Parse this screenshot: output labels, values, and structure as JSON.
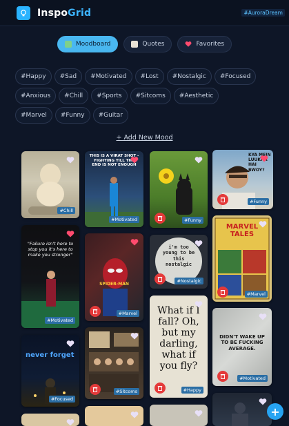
{
  "app": {
    "brand_main": "Inspo",
    "brand_accent": "Grid",
    "user_tag": "#AuroraDream"
  },
  "tabs": [
    {
      "label": "Moodboard",
      "active": true
    },
    {
      "label": "Quotes",
      "active": false
    },
    {
      "label": "Favorites",
      "active": false
    }
  ],
  "moods": [
    "#Happy",
    "#Sad",
    "#Motivated",
    "#Lost",
    "#Nostalgic",
    "#Focused",
    "#Anxious",
    "#Chill",
    "#Sports",
    "#Sitcoms",
    "#Aesthetic",
    "#Marvel",
    "#Funny",
    "#Guitar"
  ],
  "add_mood_label": "+ Add New Mood",
  "cards": [
    {
      "tag": "#Chill",
      "favorited": false,
      "caption": ""
    },
    {
      "tag": "#Motivated",
      "favorited": true,
      "caption": "THIS IS A VIRAT SHOT - FIGHTING TILL THE END IS NOT ENOUGH"
    },
    {
      "tag": "#Funny",
      "favorited": false,
      "caption": ""
    },
    {
      "tag": "#Funny",
      "favorited": true,
      "caption": "KYA MEIN LUUKHA HAI BWOY?"
    },
    {
      "tag": "#Motivated",
      "favorited": true,
      "caption": "\"Failure isn't here to stop you it's here to make you stronger\""
    },
    {
      "tag": "#Marvel",
      "favorited": true,
      "caption": "SPIDER-MAN"
    },
    {
      "tag": "#Nostalgic",
      "favorited": false,
      "caption": "i'm too young to be this nostalgic"
    },
    {
      "tag": "#Marvel",
      "favorited": false,
      "caption": "MARVEL TALES"
    },
    {
      "tag": "#Focused",
      "favorited": false,
      "caption": "never forget"
    },
    {
      "tag": "#Sitcoms",
      "favorited": false,
      "caption": ""
    },
    {
      "tag": "#Happy",
      "favorited": false,
      "caption": "What if I fall? Oh, but my darling, what if you fly?"
    },
    {
      "tag": "#Motivated",
      "favorited": false,
      "caption": "DIDN'T WAKE UP TO BE FUCKING AVERAGE."
    }
  ],
  "colors": {
    "background": "#0e1627",
    "accent": "#49b7f0",
    "heart_active": "#ff4b6e",
    "delete": "#e43a3a"
  },
  "icons": {
    "logo": "bulb-icon",
    "moodboard": "image-icon",
    "quotes": "note-icon",
    "favorites": "heart-icon",
    "fab": "plus-icon"
  },
  "fab_label": "+"
}
